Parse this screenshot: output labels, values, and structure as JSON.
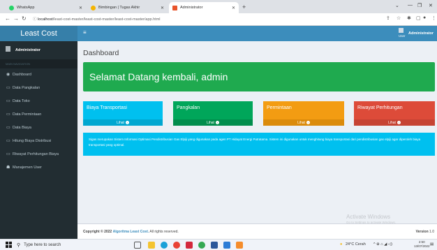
{
  "browser": {
    "tabs": [
      {
        "title": "WhatsApp",
        "fav_color": "#25d366"
      },
      {
        "title": "Bimbingan | Tugas Akhir",
        "fav_color": "#f4b400"
      },
      {
        "title": "Administrator",
        "fav_color": "#e8532a"
      }
    ],
    "url_host": "localhost",
    "url_path": "/least-cost-master/least-cost-master/least-cost-master/app.html"
  },
  "app": {
    "logo": "Least Cost",
    "user_label": "User",
    "user_name": "Administrator"
  },
  "sidebar": {
    "user_name": "Administrator",
    "header": "MAIN NAVIGATION",
    "items": [
      {
        "label": "Dashboard",
        "icon": "dashboard-icon"
      },
      {
        "label": "Data Pangkalan",
        "icon": "file-icon"
      },
      {
        "label": "Data Toko",
        "icon": "file-icon"
      },
      {
        "label": "Data Permintaan",
        "icon": "file-icon"
      },
      {
        "label": "Data Biaya",
        "icon": "file-icon"
      },
      {
        "label": "Hitung Biaya Distribusi",
        "icon": "file-icon"
      },
      {
        "label": "Riwayat Perhitungan Biaya",
        "icon": "file-icon"
      },
      {
        "label": "Manajemen User",
        "icon": "users-icon"
      }
    ]
  },
  "main": {
    "page_title": "Dashboard",
    "welcome": "Selamat Datang kembali, admin",
    "boxes": [
      {
        "label": "Biaya Transportasi",
        "link": "Lihat",
        "color": "#00c0ef",
        "foot": "#00a7d0"
      },
      {
        "label": "Pangkalan",
        "link": "Lihat",
        "color": "#00a65a",
        "foot": "#008d4c"
      },
      {
        "label": "Permintaan",
        "link": "Lihat",
        "color": "#f39c12",
        "foot": "#db8b0b"
      },
      {
        "label": "Riwayat Perhitungan",
        "link": "Lihat",
        "color": "#dd4b39",
        "foot": "#c64333"
      }
    ],
    "info": "Sigas merupakan Sistem Informasi Optimasi Pendistribusian Gas Elpiji yang digunakan pada agen PT Hidayat Energi Putratama. Sistem ini digunakan untuk menghitung biaya transportasi dari pendistribusian gas elpiji agar diperoleh biaya transportasi yang optimal."
  },
  "footer": {
    "copyright_prefix": "Copyright © 2022",
    "copyright_link": "Algoritma Least Cost.",
    "copyright_suffix": "All rights reserved.",
    "version_label": "Version",
    "version_value": "1.0"
  },
  "watermark": {
    "title": "Activate Windows",
    "subtitle": "Go to Settings to activate Windows."
  },
  "taskbar": {
    "search_placeholder": "Type here to search",
    "weather": "24°C  Cerah",
    "time": "2:50",
    "date": "13/07/2022"
  },
  "colors": {
    "logo_bg": "#367fa9",
    "header_bg": "#3c8dbc",
    "sidebar_bg": "#222d32",
    "welcome_bg": "#1faa4f",
    "info_bg": "#00c0ef"
  }
}
